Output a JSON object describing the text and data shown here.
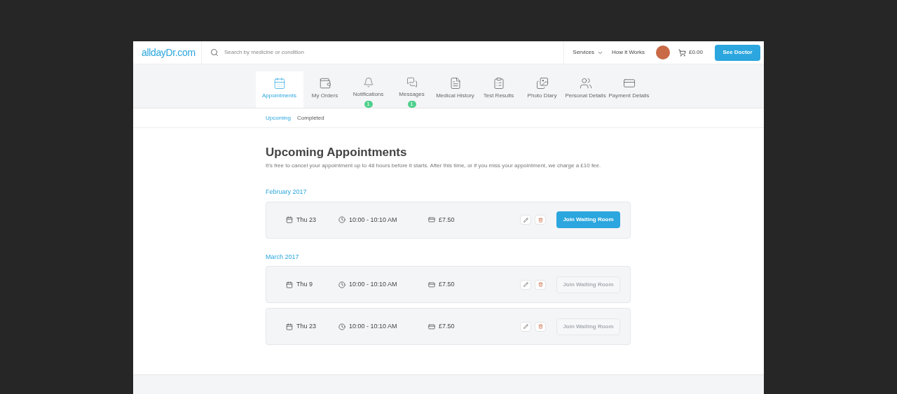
{
  "header": {
    "logo": "alldayDr.com",
    "search": {
      "placeholder": "Search by medicine or condition"
    },
    "nav": [
      "Services",
      "How it Works"
    ],
    "cart": "£0.00",
    "cta": "See Doctor"
  },
  "tabs": [
    {
      "label": "Appointments",
      "selected": true
    },
    {
      "label": "My Orders",
      "selected": false
    },
    {
      "label": "Notifications",
      "selected": false,
      "badge": "1"
    },
    {
      "label": "Messages",
      "selected": false,
      "badge": "1"
    },
    {
      "label": "Medical History",
      "selected": false
    },
    {
      "label": "Test Results",
      "selected": false
    },
    {
      "label": "Photo Diary",
      "selected": false
    },
    {
      "label": "Personal Details",
      "selected": false
    },
    {
      "label": "Payment Details",
      "selected": false
    }
  ],
  "subtabs": [
    {
      "label": "Upcoming",
      "selected": true
    },
    {
      "label": "Completed",
      "selected": false
    }
  ],
  "title": "Upcoming Appointments",
  "note": "It's free to cancel your appointment up to 48 hours before it starts. After this time, or if you miss your appointment, we charge a £10 fee.",
  "groups": [
    {
      "month": "February 2017",
      "appointments": [
        {
          "date": "Thu 23",
          "time": "10:00 - 10:10 AM",
          "price": "£7.50",
          "action": "Join Waiting Room",
          "disabled": false
        }
      ]
    },
    {
      "month": "March 2017",
      "appointments": [
        {
          "date": "Thu 9",
          "time": "10:00 - 10:10 AM",
          "price": "£7.50",
          "action": "Join Waiting Room",
          "disabled": true
        },
        {
          "date": "Thu 23",
          "time": "10:00 - 10:10 AM",
          "price": "£7.50",
          "action": "Join Waiting Room",
          "disabled": true
        }
      ]
    }
  ]
}
